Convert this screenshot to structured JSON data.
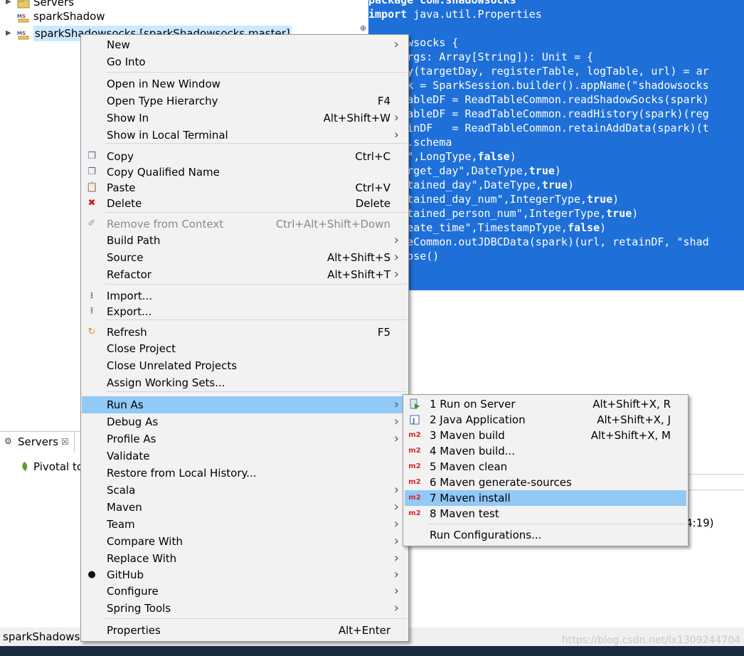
{
  "explorer": {
    "items": [
      {
        "label": "Servers"
      },
      {
        "label": "sparkShadow"
      },
      {
        "label": "sparkShadowsocks [sparkShadowsocks master]"
      }
    ]
  },
  "editor": {
    "lines": [
      {
        "pre": "package com.shadowsocks",
        "kw": "",
        "post": ""
      },
      {
        "pre": "",
        "kw": "import",
        "post": " java.util.Properties"
      },
      {
        "pre": "",
        "kw": "",
        "post": ""
      },
      {
        "pre": " Shadowsocks {",
        "kw": "",
        "post": ""
      },
      {
        "pre": "main(args: Array[String]): Unit = {",
        "kw": "",
        "post": ""
      },
      {
        "pre": "l Array(targetDay, registerTable, logTable, url) = ar",
        "kw": "",
        "post": ""
      },
      {
        "pre": "l spark = SparkSession.builder().appName(\"shadowsocks",
        "kw": "",
        "post": ""
      },
      {
        "pre": "l regTableDF = ReadTableCommon.readShadowSocks(spark)",
        "kw": "",
        "post": ""
      },
      {
        "pre": "l logTableDF = ReadTableCommon.readHistory(spark)(reg",
        "kw": "",
        "post": ""
      },
      {
        "pre": "l retainDF   = ReadTableCommon.retainAddData(spark)(t",
        "kw": "",
        "post": ""
      },
      {
        "pre": "tainDF.schema",
        "kw": "",
        "post": ""
      },
      {
        "pre": "dd(\"id\",LongType,",
        "kw": "false",
        "post": ")"
      },
      {
        "pre": "dd(\"target_day\",DateType,",
        "kw": "true",
        "post": ")"
      },
      {
        "pre": "dd(\"retained_day\",DateType,",
        "kw": "true",
        "post": ")"
      },
      {
        "pre": "dd(\"retained_day_num\",IntegerType,",
        "kw": "true",
        "post": ")"
      },
      {
        "pre": "dd(\"retained_person_num\",IntegerType,",
        "kw": "true",
        "post": ")"
      },
      {
        "pre": "dd(\"create_time\",TimestampType,",
        "kw": "false",
        "post": ")"
      },
      {
        "pre": "adTableCommon.outJDBCData(spark)(url, retainDF, \"shad",
        "kw": "",
        "post": ""
      },
      {
        "pre": "ark.close()",
        "kw": "",
        "post": ""
      }
    ]
  },
  "servers_view": {
    "tab_label": "Servers",
    "item": "Pivotal tc"
  },
  "status_bar": {
    "text": "sparkShadowsc"
  },
  "console_fragment": "4:19)",
  "context_menu": {
    "items": [
      {
        "label": "New",
        "shortcut": "",
        "submenu": true
      },
      {
        "label": "Go Into",
        "shortcut": "",
        "submenu": false
      },
      {
        "label": "Open in New Window",
        "shortcut": "",
        "submenu": false
      },
      {
        "label": "Open Type Hierarchy",
        "shortcut": "F4",
        "submenu": false
      },
      {
        "label": "Show In",
        "shortcut": "Alt+Shift+W",
        "submenu": true
      },
      {
        "label": "Show in Local Terminal",
        "shortcut": "",
        "submenu": true
      },
      {
        "label": "Copy",
        "shortcut": "Ctrl+C",
        "submenu": false
      },
      {
        "label": "Copy Qualified Name",
        "shortcut": "",
        "submenu": false
      },
      {
        "label": "Paste",
        "shortcut": "Ctrl+V",
        "submenu": false
      },
      {
        "label": "Delete",
        "shortcut": "Delete",
        "submenu": false
      },
      {
        "label": "Remove from Context",
        "shortcut": "Ctrl+Alt+Shift+Down",
        "submenu": false
      },
      {
        "label": "Build Path",
        "shortcut": "",
        "submenu": true
      },
      {
        "label": "Source",
        "shortcut": "Alt+Shift+S",
        "submenu": true
      },
      {
        "label": "Refactor",
        "shortcut": "Alt+Shift+T",
        "submenu": true
      },
      {
        "label": "Import...",
        "shortcut": "",
        "submenu": false
      },
      {
        "label": "Export...",
        "shortcut": "",
        "submenu": false
      },
      {
        "label": "Refresh",
        "shortcut": "F5",
        "submenu": false
      },
      {
        "label": "Close Project",
        "shortcut": "",
        "submenu": false
      },
      {
        "label": "Close Unrelated Projects",
        "shortcut": "",
        "submenu": false
      },
      {
        "label": "Assign Working Sets...",
        "shortcut": "",
        "submenu": false
      },
      {
        "label": "Run As",
        "shortcut": "",
        "submenu": true
      },
      {
        "label": "Debug As",
        "shortcut": "",
        "submenu": true
      },
      {
        "label": "Profile As",
        "shortcut": "",
        "submenu": true
      },
      {
        "label": "Validate",
        "shortcut": "",
        "submenu": false
      },
      {
        "label": "Restore from Local History...",
        "shortcut": "",
        "submenu": false
      },
      {
        "label": "Scala",
        "shortcut": "",
        "submenu": true
      },
      {
        "label": "Maven",
        "shortcut": "",
        "submenu": true
      },
      {
        "label": "Team",
        "shortcut": "",
        "submenu": true
      },
      {
        "label": "Compare With",
        "shortcut": "",
        "submenu": true
      },
      {
        "label": "Replace With",
        "shortcut": "",
        "submenu": true
      },
      {
        "label": "GitHub",
        "shortcut": "",
        "submenu": true
      },
      {
        "label": "Configure",
        "shortcut": "",
        "submenu": true
      },
      {
        "label": "Spring Tools",
        "shortcut": "",
        "submenu": true
      },
      {
        "label": "Properties",
        "shortcut": "Alt+Enter",
        "submenu": false
      }
    ],
    "icons": {
      "copy": "copy-icon",
      "copy_qualified": "copy-qualified-name-icon",
      "paste": "paste-icon",
      "delete": "delete-icon",
      "remove_context": "remove-from-context-icon",
      "import": "import-icon",
      "export": "export-icon",
      "refresh": "refresh-icon",
      "github": "github-icon"
    }
  },
  "run_as_submenu": {
    "items": [
      {
        "label": "1 Run on Server",
        "shortcut": "Alt+Shift+X, R"
      },
      {
        "label": "2 Java Application",
        "shortcut": "Alt+Shift+X, J"
      },
      {
        "label": "3 Maven build",
        "shortcut": "Alt+Shift+X, M"
      },
      {
        "label": "4 Maven build...",
        "shortcut": ""
      },
      {
        "label": "5 Maven clean",
        "shortcut": ""
      },
      {
        "label": "6 Maven generate-sources",
        "shortcut": ""
      },
      {
        "label": "7 Maven install",
        "shortcut": ""
      },
      {
        "label": "8 Maven test",
        "shortcut": ""
      },
      {
        "label": "Run Configurations...",
        "shortcut": ""
      }
    ],
    "m2_badge": "m2"
  },
  "watermark": "https://blog.csdn.net/lx1309244704",
  "colors": {
    "selection_blue": "#1e6fd8",
    "menu_highlight": "#91c9f7",
    "menu_bg": "#f2f2f2",
    "m2_red": "#d6262b"
  }
}
